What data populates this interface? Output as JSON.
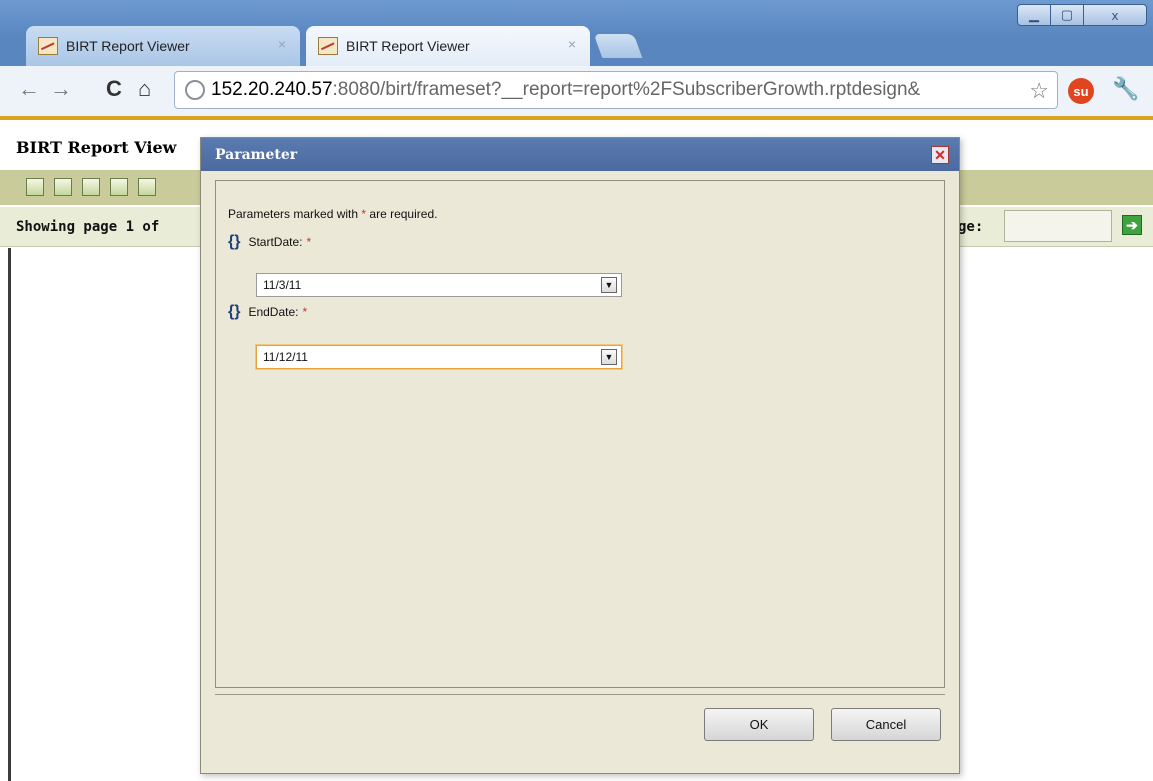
{
  "browser": {
    "tabs": [
      {
        "label": "BIRT Report Viewer",
        "active": false
      },
      {
        "label": "BIRT Report Viewer",
        "active": true
      }
    ],
    "url_host": "152.20.240.57",
    "url_rest": ":8080/birt/frameset?__report=report%2FSubscriberGrowth.rptdesign&",
    "window_controls": {
      "close": "x"
    }
  },
  "viewer": {
    "title": "BIRT Report View",
    "status_text": "Showing page  1  of",
    "goto_label": "ge:",
    "goto_value": ""
  },
  "dialog": {
    "title": "Parameter",
    "required_note": "Parameters marked with",
    "required_note_suffix": "are required.",
    "asterisk": "*",
    "params": [
      {
        "label": "StartDate:",
        "value": "11/3/11"
      },
      {
        "label": "EndDate:",
        "value": "11/12/11"
      }
    ],
    "ok_label": "OK",
    "cancel_label": "Cancel"
  },
  "colors": {
    "dialog_header": "#4a6aa0",
    "toolbar": "#c9cc9a",
    "required": "#d03030",
    "accent_gold": "#d9a521"
  }
}
